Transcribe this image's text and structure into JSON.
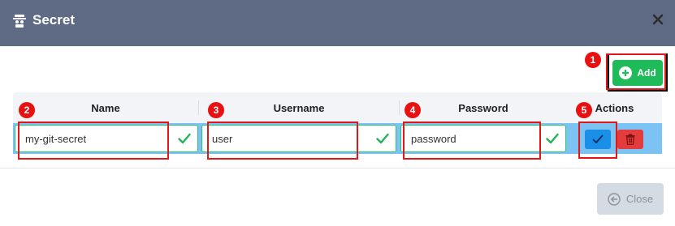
{
  "dialog": {
    "title": "Secret",
    "add_label": "Add",
    "close_label": "Close"
  },
  "table": {
    "columns": [
      "Name",
      "Username",
      "Password",
      "Actions"
    ],
    "row": {
      "name": "my-git-secret",
      "username": "user",
      "password": "password"
    }
  },
  "annotations": [
    "1",
    "2",
    "3",
    "4",
    "5"
  ],
  "colors": {
    "header_bg": "#5f6b84",
    "add_green": "#1fba5a",
    "row_highlight": "#7cc3f4",
    "save_blue": "#1a8fe8",
    "delete_red": "#e33c3c",
    "annotation_red": "#e21616"
  },
  "icons": {
    "title": "secret-icon",
    "close": "close-icon",
    "add": "plus-circle-icon",
    "valid": "check-icon",
    "save": "checkmark-icon",
    "delete": "trash-icon",
    "close_button": "back-arrow-icon"
  }
}
